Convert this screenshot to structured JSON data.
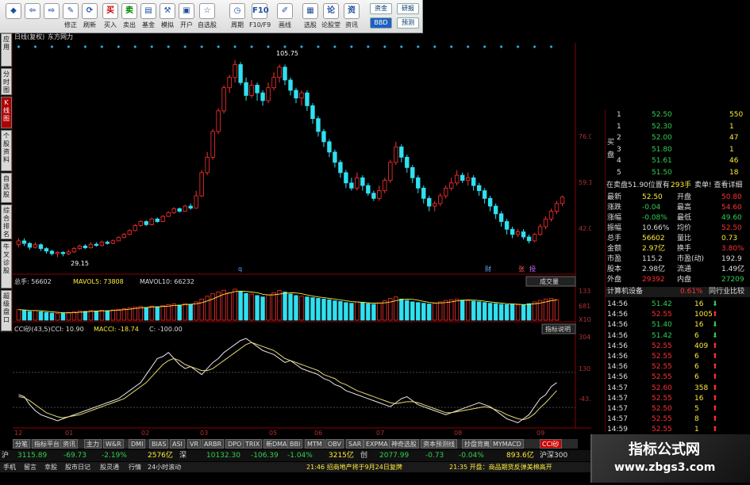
{
  "toolbar": {
    "items": [
      {
        "label": "",
        "icon": "◆"
      },
      {
        "label": "",
        "icon": "⇦"
      },
      {
        "label": "",
        "icon": "⇨"
      },
      {
        "label": "修正",
        "icon": "✎"
      },
      {
        "label": "刷新",
        "icon": "⟳"
      },
      {
        "label": "买入",
        "icon": "买"
      },
      {
        "label": "卖出",
        "icon": "卖"
      },
      {
        "label": "基金",
        "icon": "▤"
      },
      {
        "label": "模拟",
        "icon": "⚒"
      },
      {
        "label": "开户",
        "icon": "▣"
      },
      {
        "label": "自选股",
        "icon": "☆"
      },
      {
        "label": "周期",
        "icon": "◷"
      },
      {
        "label": "F10/F9",
        "icon": "F10"
      },
      {
        "label": "画线",
        "icon": "✐"
      },
      {
        "label": "选股",
        "icon": "▦"
      },
      {
        "label": "论股堂",
        "icon": "论"
      },
      {
        "label": "资讯",
        "icon": "资"
      }
    ],
    "right": [
      {
        "label": "资金"
      },
      {
        "label": "研报"
      },
      {
        "label": "BBD"
      },
      {
        "label": "预测"
      }
    ]
  },
  "side_tabs": [
    {
      "label": "应用"
    },
    {
      "label": "分时图"
    },
    {
      "label": "K线图"
    },
    {
      "label": "个股资料"
    },
    {
      "label": "自选股"
    },
    {
      "label": "综合排名"
    },
    {
      "label": "牛叉诊股"
    },
    {
      "label": "超级盘口"
    }
  ],
  "chart_header": {
    "title": "日线(复权)",
    "name": "东方网力"
  },
  "price_axis": {
    "ticks": [
      "76.01",
      "59.12",
      "42.01"
    ],
    "high_label": "105.75",
    "low_label": "29.15"
  },
  "volume_header": {
    "a": "总手: 56602",
    "b": "MAVOL5: 73808",
    "c": "MAVOL10: 66232",
    "btn": "成交量",
    "ticks": [
      "13385",
      "6814",
      "X10"
    ]
  },
  "cci_header": {
    "a": "CCI砂(43,5)",
    "b": "CCI: 10.90",
    "c": "MACCI: -18.74",
    "d": "C: -100.00",
    "btn": "指标说明",
    "ticks": [
      "304.97",
      "130.72",
      "-43.52"
    ]
  },
  "x_axis": [
    "12",
    "01",
    "02",
    "03",
    "05",
    "06",
    "07",
    "08",
    "09"
  ],
  "markers": {
    "q": "q",
    "cai": "财",
    "zhang": "张",
    "shou": "授"
  },
  "chart_data": {
    "type": "candlestick",
    "price_ylim": [
      25,
      110
    ],
    "candles": [
      {
        "o": 34,
        "c": 35.5,
        "h": 36.5,
        "l": 33
      },
      {
        "o": 35.5,
        "c": 34.5,
        "h": 36.5,
        "l": 33.5
      },
      {
        "o": 34.5,
        "c": 33,
        "h": 35,
        "l": 32
      },
      {
        "o": 33,
        "c": 34,
        "h": 35,
        "l": 32.5
      },
      {
        "o": 34,
        "c": 32.5,
        "h": 34.5,
        "l": 31.5
      },
      {
        "o": 32.5,
        "c": 31.5,
        "h": 33,
        "l": 30.5
      },
      {
        "o": 31.5,
        "c": 30.5,
        "h": 32,
        "l": 29.8
      },
      {
        "o": 30.5,
        "c": 31,
        "h": 31.5,
        "l": 29.15
      },
      {
        "o": 31,
        "c": 30.5,
        "h": 31.5,
        "l": 29.5
      },
      {
        "o": 30.5,
        "c": 31.2,
        "h": 32,
        "l": 30
      },
      {
        "o": 31.2,
        "c": 32.5,
        "h": 33,
        "l": 30.8
      },
      {
        "o": 32.5,
        "c": 33.5,
        "h": 34,
        "l": 32
      },
      {
        "o": 33.5,
        "c": 32.8,
        "h": 34.2,
        "l": 32.3
      },
      {
        "o": 32.8,
        "c": 34.2,
        "h": 35,
        "l": 32.5
      },
      {
        "o": 34.2,
        "c": 33.7,
        "h": 35,
        "l": 33.2
      },
      {
        "o": 33.7,
        "c": 35,
        "h": 35.6,
        "l": 33.3
      },
      {
        "o": 35,
        "c": 34.5,
        "h": 35.6,
        "l": 34
      },
      {
        "o": 34.5,
        "c": 35.5,
        "h": 36,
        "l": 34.2
      },
      {
        "o": 35.5,
        "c": 36.8,
        "h": 37.2,
        "l": 35.3
      },
      {
        "o": 36.8,
        "c": 38,
        "h": 38.5,
        "l": 36.5
      },
      {
        "o": 38,
        "c": 39.5,
        "h": 40,
        "l": 37.6
      },
      {
        "o": 39.5,
        "c": 41.5,
        "h": 42,
        "l": 39.2
      },
      {
        "o": 41.5,
        "c": 43,
        "h": 43.6,
        "l": 41
      },
      {
        "o": 43,
        "c": 41.8,
        "h": 43.5,
        "l": 41.2
      },
      {
        "o": 41.8,
        "c": 44,
        "h": 44.5,
        "l": 41.5
      },
      {
        "o": 44,
        "c": 43,
        "h": 44.6,
        "l": 42.5
      },
      {
        "o": 43,
        "c": 45,
        "h": 45.5,
        "l": 42.8
      },
      {
        "o": 45,
        "c": 46.5,
        "h": 47,
        "l": 44.8
      },
      {
        "o": 46.5,
        "c": 48,
        "h": 48.6,
        "l": 46
      },
      {
        "o": 48,
        "c": 47,
        "h": 48.5,
        "l": 46.5
      },
      {
        "o": 47,
        "c": 49,
        "h": 49.5,
        "l": 46.8
      },
      {
        "o": 49,
        "c": 48.2,
        "h": 50,
        "l": 47.6
      },
      {
        "o": 48.2,
        "c": 53,
        "h": 55,
        "l": 48
      },
      {
        "o": 53,
        "c": 62,
        "h": 63,
        "l": 52.5
      },
      {
        "o": 62,
        "c": 68,
        "h": 70,
        "l": 61
      },
      {
        "o": 68,
        "c": 78,
        "h": 79,
        "l": 67
      },
      {
        "o": 78,
        "c": 86,
        "h": 87,
        "l": 77
      },
      {
        "o": 86,
        "c": 95,
        "h": 96,
        "l": 85
      },
      {
        "o": 95,
        "c": 99,
        "h": 100,
        "l": 93
      },
      {
        "o": 99,
        "c": 104,
        "h": 105.75,
        "l": 97
      },
      {
        "o": 104,
        "c": 97,
        "h": 105,
        "l": 96
      },
      {
        "o": 97,
        "c": 92,
        "h": 99,
        "l": 90
      },
      {
        "o": 92,
        "c": 96,
        "h": 98,
        "l": 91
      },
      {
        "o": 96,
        "c": 93,
        "h": 97,
        "l": 90
      },
      {
        "o": 93,
        "c": 90,
        "h": 94,
        "l": 88
      },
      {
        "o": 90,
        "c": 95,
        "h": 97,
        "l": 89
      },
      {
        "o": 95,
        "c": 99,
        "h": 101,
        "l": 94
      },
      {
        "o": 99,
        "c": 103,
        "h": 104,
        "l": 97
      },
      {
        "o": 103,
        "c": 98,
        "h": 104,
        "l": 96
      },
      {
        "o": 98,
        "c": 94,
        "h": 99,
        "l": 92
      },
      {
        "o": 94,
        "c": 91,
        "h": 95,
        "l": 89
      },
      {
        "o": 91,
        "c": 93,
        "h": 94,
        "l": 88
      },
      {
        "o": 93,
        "c": 88,
        "h": 94,
        "l": 86
      },
      {
        "o": 88,
        "c": 83,
        "h": 89,
        "l": 81
      },
      {
        "o": 83,
        "c": 78,
        "h": 84,
        "l": 76
      },
      {
        "o": 78,
        "c": 74,
        "h": 79,
        "l": 72
      },
      {
        "o": 74,
        "c": 70,
        "h": 75,
        "l": 68
      },
      {
        "o": 70,
        "c": 66,
        "h": 71,
        "l": 64
      },
      {
        "o": 66,
        "c": 62,
        "h": 67,
        "l": 60
      },
      {
        "o": 62,
        "c": 58,
        "h": 63,
        "l": 56
      },
      {
        "o": 58,
        "c": 56,
        "h": 60,
        "l": 55
      },
      {
        "o": 56,
        "c": 60,
        "h": 62,
        "l": 55
      },
      {
        "o": 60,
        "c": 57,
        "h": 61,
        "l": 55
      },
      {
        "o": 57,
        "c": 54,
        "h": 58,
        "l": 53
      },
      {
        "o": 54,
        "c": 52,
        "h": 55,
        "l": 51
      },
      {
        "o": 52,
        "c": 55,
        "h": 57,
        "l": 51
      },
      {
        "o": 55,
        "c": 59,
        "h": 60,
        "l": 54
      },
      {
        "o": 59,
        "c": 66,
        "h": 67,
        "l": 58
      },
      {
        "o": 66,
        "c": 72,
        "h": 74,
        "l": 65
      },
      {
        "o": 72,
        "c": 68,
        "h": 73,
        "l": 66
      },
      {
        "o": 68,
        "c": 64,
        "h": 69,
        "l": 62
      },
      {
        "o": 64,
        "c": 60,
        "h": 65,
        "l": 58
      },
      {
        "o": 60,
        "c": 56,
        "h": 61,
        "l": 54
      },
      {
        "o": 56,
        "c": 52,
        "h": 57,
        "l": 50
      },
      {
        "o": 52,
        "c": 49,
        "h": 53,
        "l": 47
      },
      {
        "o": 49,
        "c": 50,
        "h": 51,
        "l": 47
      },
      {
        "o": 50,
        "c": 53,
        "h": 54,
        "l": 49
      },
      {
        "o": 53,
        "c": 56,
        "h": 57,
        "l": 52
      },
      {
        "o": 56,
        "c": 58,
        "h": 60,
        "l": 55
      },
      {
        "o": 58,
        "c": 61,
        "h": 63,
        "l": 57
      },
      {
        "o": 61,
        "c": 59,
        "h": 62,
        "l": 58
      },
      {
        "o": 59,
        "c": 60,
        "h": 62,
        "l": 57
      },
      {
        "o": 60,
        "c": 57,
        "h": 61,
        "l": 55
      },
      {
        "o": 57,
        "c": 55,
        "h": 58,
        "l": 53
      },
      {
        "o": 55,
        "c": 52,
        "h": 56,
        "l": 50
      },
      {
        "o": 52,
        "c": 49,
        "h": 53,
        "l": 47
      },
      {
        "o": 49,
        "c": 46,
        "h": 50,
        "l": 44
      },
      {
        "o": 46,
        "c": 43,
        "h": 47,
        "l": 41
      },
      {
        "o": 43,
        "c": 40,
        "h": 44,
        "l": 38
      },
      {
        "o": 40,
        "c": 38,
        "h": 41,
        "l": 36.5
      },
      {
        "o": 38,
        "c": 39,
        "h": 40,
        "l": 37
      },
      {
        "o": 39,
        "c": 37,
        "h": 40,
        "l": 36
      },
      {
        "o": 37,
        "c": 35.5,
        "h": 38,
        "l": 34.5
      },
      {
        "o": 35.5,
        "c": 38,
        "h": 38.5,
        "l": 35
      },
      {
        "o": 38,
        "c": 41,
        "h": 42,
        "l": 37.5
      },
      {
        "o": 41,
        "c": 44,
        "h": 45,
        "l": 40
      },
      {
        "o": 44,
        "c": 47,
        "h": 48,
        "l": 43
      },
      {
        "o": 47,
        "c": 50,
        "h": 51,
        "l": 46
      },
      {
        "o": 50,
        "c": 52.5,
        "h": 53,
        "l": 49
      }
    ],
    "volume": [
      30,
      28,
      25,
      27,
      24,
      22,
      20,
      19,
      21,
      22,
      24,
      26,
      25,
      27,
      26,
      28,
      27,
      29,
      31,
      33,
      35,
      37,
      39,
      36,
      40,
      38,
      41,
      44,
      46,
      43,
      47,
      45,
      52,
      60,
      68,
      75,
      80,
      85,
      78,
      88,
      82,
      76,
      74,
      70,
      66,
      72,
      78,
      84,
      80,
      74,
      70,
      68,
      66,
      64,
      62,
      60,
      58,
      55,
      53,
      50,
      48,
      52,
      50,
      47,
      45,
      49,
      55,
      62,
      66,
      60,
      56,
      52,
      50,
      48,
      46,
      48,
      52,
      56,
      58,
      60,
      57,
      56,
      54,
      52,
      50,
      48,
      47,
      45,
      44,
      46,
      44,
      43,
      47,
      52,
      56,
      60,
      62,
      58
    ],
    "cci": [
      20,
      10,
      -30,
      -60,
      -80,
      -90,
      -100,
      -110,
      -100,
      -90,
      -80,
      -70,
      -60,
      -50,
      -40,
      -30,
      -20,
      -10,
      0,
      20,
      40,
      60,
      80,
      120,
      160,
      200,
      210,
      230,
      200,
      170,
      150,
      160,
      140,
      120,
      150,
      180,
      200,
      230,
      250,
      270,
      290,
      300,
      280,
      260,
      240,
      230,
      220,
      200,
      180,
      190,
      170,
      150,
      140,
      130,
      120,
      100,
      90,
      70,
      60,
      40,
      30,
      20,
      10,
      0,
      -10,
      -20,
      -30,
      -40,
      -20,
      0,
      10,
      -10,
      -30,
      -40,
      -50,
      -60,
      -70,
      -80,
      -70,
      -60,
      -50,
      -40,
      -30,
      -20,
      -30,
      -40,
      -60,
      -80,
      -100,
      -110,
      -120,
      -100,
      -80,
      -40,
      0,
      20,
      60,
      80
    ],
    "maxcci": [
      10,
      5,
      -10,
      -30,
      -50,
      -70,
      -80,
      -90,
      -95,
      -90,
      -85,
      -80,
      -70,
      -60,
      -50,
      -40,
      -30,
      -20,
      -10,
      0,
      20,
      40,
      60,
      80,
      110,
      140,
      170,
      190,
      200,
      190,
      170,
      160,
      150,
      140,
      140,
      150,
      170,
      190,
      210,
      230,
      250,
      270,
      280,
      270,
      260,
      250,
      240,
      220,
      200,
      190,
      180,
      170,
      160,
      150,
      140,
      120,
      110,
      100,
      80,
      70,
      55,
      40,
      30,
      20,
      10,
      0,
      -10,
      -20,
      -25,
      -20,
      -15,
      -15,
      -20,
      -30,
      -40,
      -50,
      -60,
      -70,
      -70,
      -65,
      -60,
      -55,
      -50,
      -45,
      -40,
      -45,
      -55,
      -65,
      -80,
      -90,
      -100,
      -105,
      -95,
      -75,
      -45,
      -20,
      10,
      40
    ],
    "cci_ylim": [
      -130,
      320
    ]
  },
  "quote": {
    "buy_levels": [
      {
        "n": "1",
        "p": "52.50",
        "v": "550"
      },
      {
        "n": "1",
        "p": "52.30",
        "v": "1"
      },
      {
        "n": "2",
        "p": "52.00",
        "v": "47"
      },
      {
        "n": "3",
        "p": "51.80",
        "v": "1"
      },
      {
        "n": "4",
        "p": "51.61",
        "v": "46"
      },
      {
        "n": "5",
        "p": "51.50",
        "v": "18"
      }
    ],
    "buy_label": "买 盘",
    "position_line": {
      "a": "在卖盘51.90位置有",
      "b": "293手",
      "c": "卖单! 查看详细"
    },
    "stats": [
      {
        "l": "最新",
        "v": "52.50",
        "l2": "开盘",
        "v2": "50.80"
      },
      {
        "l": "涨跌",
        "v": "-0.04",
        "l2": "最高",
        "v2": "54.60"
      },
      {
        "l": "涨幅",
        "v": "-0.08%",
        "l2": "最低",
        "v2": "49.60"
      },
      {
        "l": "振幅",
        "v": "10.66%",
        "l2": "均价",
        "v2": "52.50"
      },
      {
        "l": "总手",
        "v": "56602",
        "l2": "量比",
        "v2": "0.73"
      },
      {
        "l": "金额",
        "v": "2.97亿",
        "l2": "换手",
        "v2": "3.80%"
      },
      {
        "l": "市盈",
        "v": "115.2",
        "l2": "市盈(动)",
        "v2": "192.9"
      },
      {
        "l": "股本",
        "v": "2.98亿",
        "l2": "流通",
        "v2": "1.49亿"
      },
      {
        "l": "外盘",
        "v": "29392",
        "l2": "内盘",
        "v2": "27209"
      }
    ],
    "industry": {
      "a": "计算机设备",
      "b": "0.61%",
      "c": "同行业比较"
    },
    "ticks": [
      {
        "t": "14:56",
        "p": "51.42",
        "v": "16"
      },
      {
        "t": "14:56",
        "p": "52.55",
        "v": "1005"
      },
      {
        "t": "14:56",
        "p": "51.40",
        "v": "16"
      },
      {
        "t": "14:56",
        "p": "51.42",
        "v": "6"
      },
      {
        "t": "14:56",
        "p": "52.55",
        "v": "409"
      },
      {
        "t": "14:56",
        "p": "52.55",
        "v": "6"
      },
      {
        "t": "14:56",
        "p": "52.55",
        "v": "6"
      },
      {
        "t": "14:56",
        "p": "52.55",
        "v": "6"
      },
      {
        "t": "14:57",
        "p": "52.60",
        "v": "358"
      },
      {
        "t": "14:57",
        "p": "52.55",
        "v": "16"
      },
      {
        "t": "14:57",
        "p": "52.50",
        "v": "5"
      },
      {
        "t": "14:57",
        "p": "52.55",
        "v": "8"
      },
      {
        "t": "14:59",
        "p": "52.55",
        "v": "1"
      }
    ]
  },
  "bottom_tabs": [
    "分笔",
    "指标平台",
    "资讯",
    "主力",
    "W&R",
    "DMI",
    "BIAS",
    "ASI",
    "VR",
    "ARBR",
    "DPO",
    "TRIX",
    "新DMA",
    "BBI",
    "MTM",
    "OBV",
    "SAR",
    "EXPMA",
    "神奇选股",
    "资本预测线",
    "抄盘背离",
    "MYMACD",
    "CCI砂"
  ],
  "ticker": {
    "sh": "沪",
    "sh_idx": "3115.89",
    "sh_chg": "-69.73",
    "sh_pct": "-2.19%",
    "sh_amt": "2576亿",
    "sz": "深",
    "sz_idx": "10132.30",
    "sz_chg": "-106.39",
    "sz_pct": "-1.04%",
    "sz_amt": "3215亿",
    "cy": "创",
    "cy_idx": "2077.99",
    "cy_chg": "-0.73",
    "cy_pct": "-0.04%",
    "hs_amt": "893.6亿",
    "hs": "沪深300"
  },
  "status": {
    "items": [
      "手机",
      "留言",
      "幸股",
      "股市日记",
      "股灵通",
      "行情",
      "24小时滚动"
    ],
    "news1": "21:46 招商地产将于9月24日复牌",
    "news2": "21:35 开盘：商品期货反弹美棉高开"
  },
  "watermark": {
    "title": "指标公式网",
    "url": "www.zbgs3.com"
  },
  "colors": {
    "up": "#ff3030",
    "down": "#30e0f0",
    "axis": "#8b0000",
    "grid": "#505050"
  }
}
